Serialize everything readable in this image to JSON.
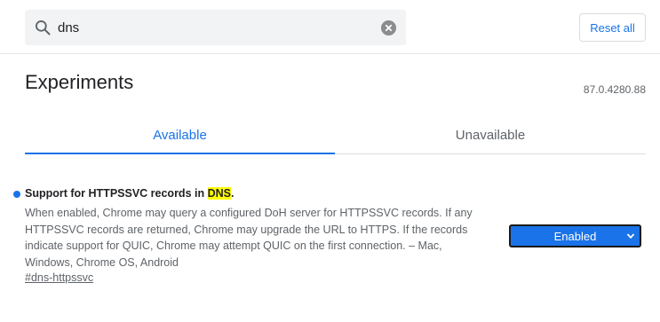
{
  "search": {
    "value": "dns",
    "placeholder": "Search flags"
  },
  "header": {
    "reset_label": "Reset all"
  },
  "page": {
    "title": "Experiments",
    "version": "87.0.4280.88"
  },
  "tabs": [
    {
      "label": "Available",
      "active": true
    },
    {
      "label": "Unavailable",
      "active": false
    }
  ],
  "experiment": {
    "title_prefix": "Support for HTTPSSVC records in ",
    "title_highlight": "DNS",
    "title_suffix": ".",
    "description_lines": [
      "When enabled, Chrome may query a configured DoH server for HTTPSSVC records. If any",
      "HTTPSSVC records are returned, Chrome may upgrade the URL to HTTPS. If the records",
      "indicate support for QUIC, Chrome may attempt QUIC on the first connection. – Mac,",
      "Windows, Chrome OS, Android"
    ],
    "link": "#dns-httpssvc",
    "selected_option": "Enabled"
  },
  "icons": {
    "search": "search-icon",
    "clear": "clear-icon",
    "dropdown": "chevron-down-icon",
    "modified": "modified-dot"
  },
  "colors": {
    "accent": "#1a73e8",
    "highlight": "#ffff00"
  }
}
